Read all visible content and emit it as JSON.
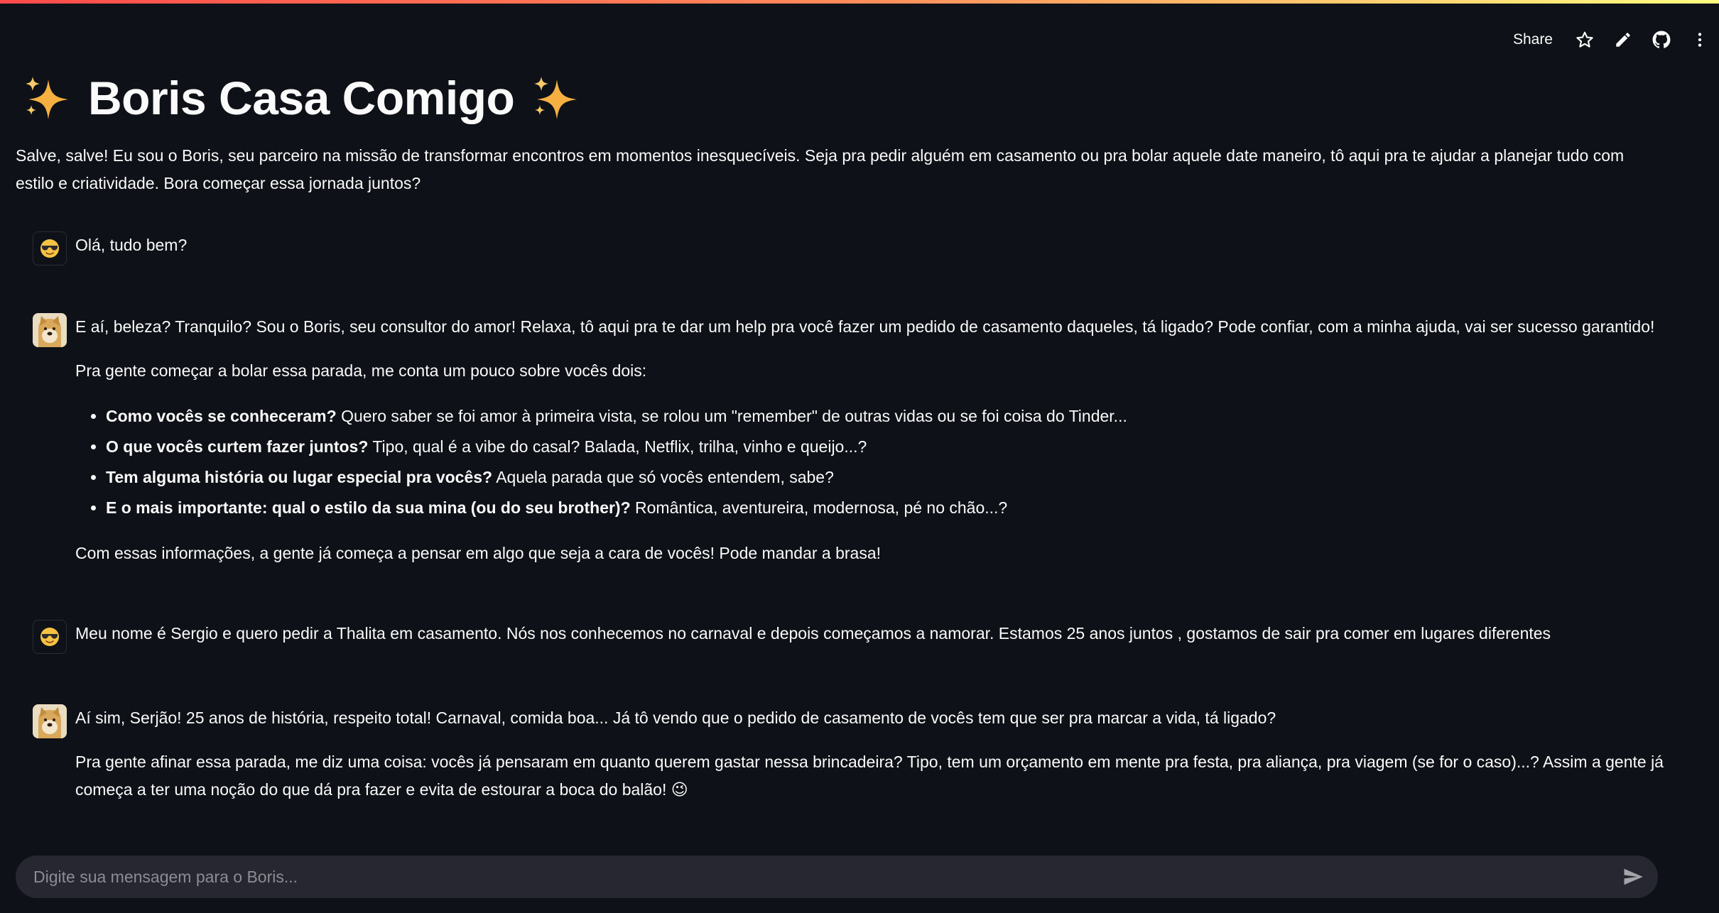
{
  "toolbar": {
    "share_label": "Share",
    "icons": [
      "star-icon",
      "pencil-icon",
      "github-icon",
      "more-vertical-icon"
    ]
  },
  "header": {
    "title": "Boris Casa Comigo",
    "emoji": "✨"
  },
  "intro": "Salve, salve! Eu sou o Boris, seu parceiro na missão de transformar encontros em momentos inesquecíveis. Seja pra pedir alguém em casamento ou pra bolar aquele date maneiro, tô aqui pra te ajudar a planejar tudo com estilo e criatividade. Bora começar essa jornada juntos?",
  "messages": {
    "m1": {
      "role": "user",
      "text": "Olá, tudo bem?"
    },
    "m2": {
      "role": "assistant",
      "p1": "E aí, beleza? Tranquilo? Sou o Boris, seu consultor do amor! Relaxa, tô aqui pra te dar um help pra você fazer um pedido de casamento daqueles, tá ligado? Pode confiar, com a minha ajuda, vai ser sucesso garantido!",
      "p2": "Pra gente começar a bolar essa parada, me conta um pouco sobre vocês dois:",
      "bullets": [
        {
          "bold": "Como vocês se conheceram?",
          "rest": " Quero saber se foi amor à primeira vista, se rolou um \"remember\" de outras vidas ou se foi coisa do Tinder..."
        },
        {
          "bold": "O que vocês curtem fazer juntos?",
          "rest": " Tipo, qual é a vibe do casal? Balada, Netflix, trilha, vinho e queijo...?"
        },
        {
          "bold": "Tem alguma história ou lugar especial pra vocês?",
          "rest": " Aquela parada que só vocês entendem, sabe?"
        },
        {
          "bold": "E o mais importante: qual o estilo da sua mina (ou do seu brother)?",
          "rest": " Romântica, aventureira, modernosa, pé no chão...?"
        }
      ],
      "p3": "Com essas informações, a gente já começa a pensar em algo que seja a cara de vocês! Pode mandar a brasa!"
    },
    "m3": {
      "role": "user",
      "text": "Meu nome é Sergio e quero pedir a Thalita em casamento. Nós nos conhecemos no carnaval e depois começamos a namorar. Estamos 25 anos juntos , gostamos de sair pra comer em lugares diferentes"
    },
    "m4": {
      "role": "assistant",
      "p1": "Aí sim, Serjão! 25 anos de história, respeito total! Carnaval, comida boa... Já tô vendo que o pedido de casamento de vocês tem que ser pra marcar a vida, tá ligado?",
      "p2": "Pra gente afinar essa parada, me diz uma coisa: vocês já pensaram em quanto querem gastar nessa brincadeira? Tipo, tem um orçamento em mente pra festa, pra aliança, pra viagem (se for o caso)...? Assim a gente já começa a ter uma noção do que dá pra fazer e evita de estourar a boca do balão!",
      "emoji": "😉"
    }
  },
  "chat_input": {
    "placeholder": "Digite sua mensagem para o Boris..."
  },
  "colors": {
    "background": "#0e1117",
    "input_bg": "#262730",
    "text": "#fafafa"
  }
}
